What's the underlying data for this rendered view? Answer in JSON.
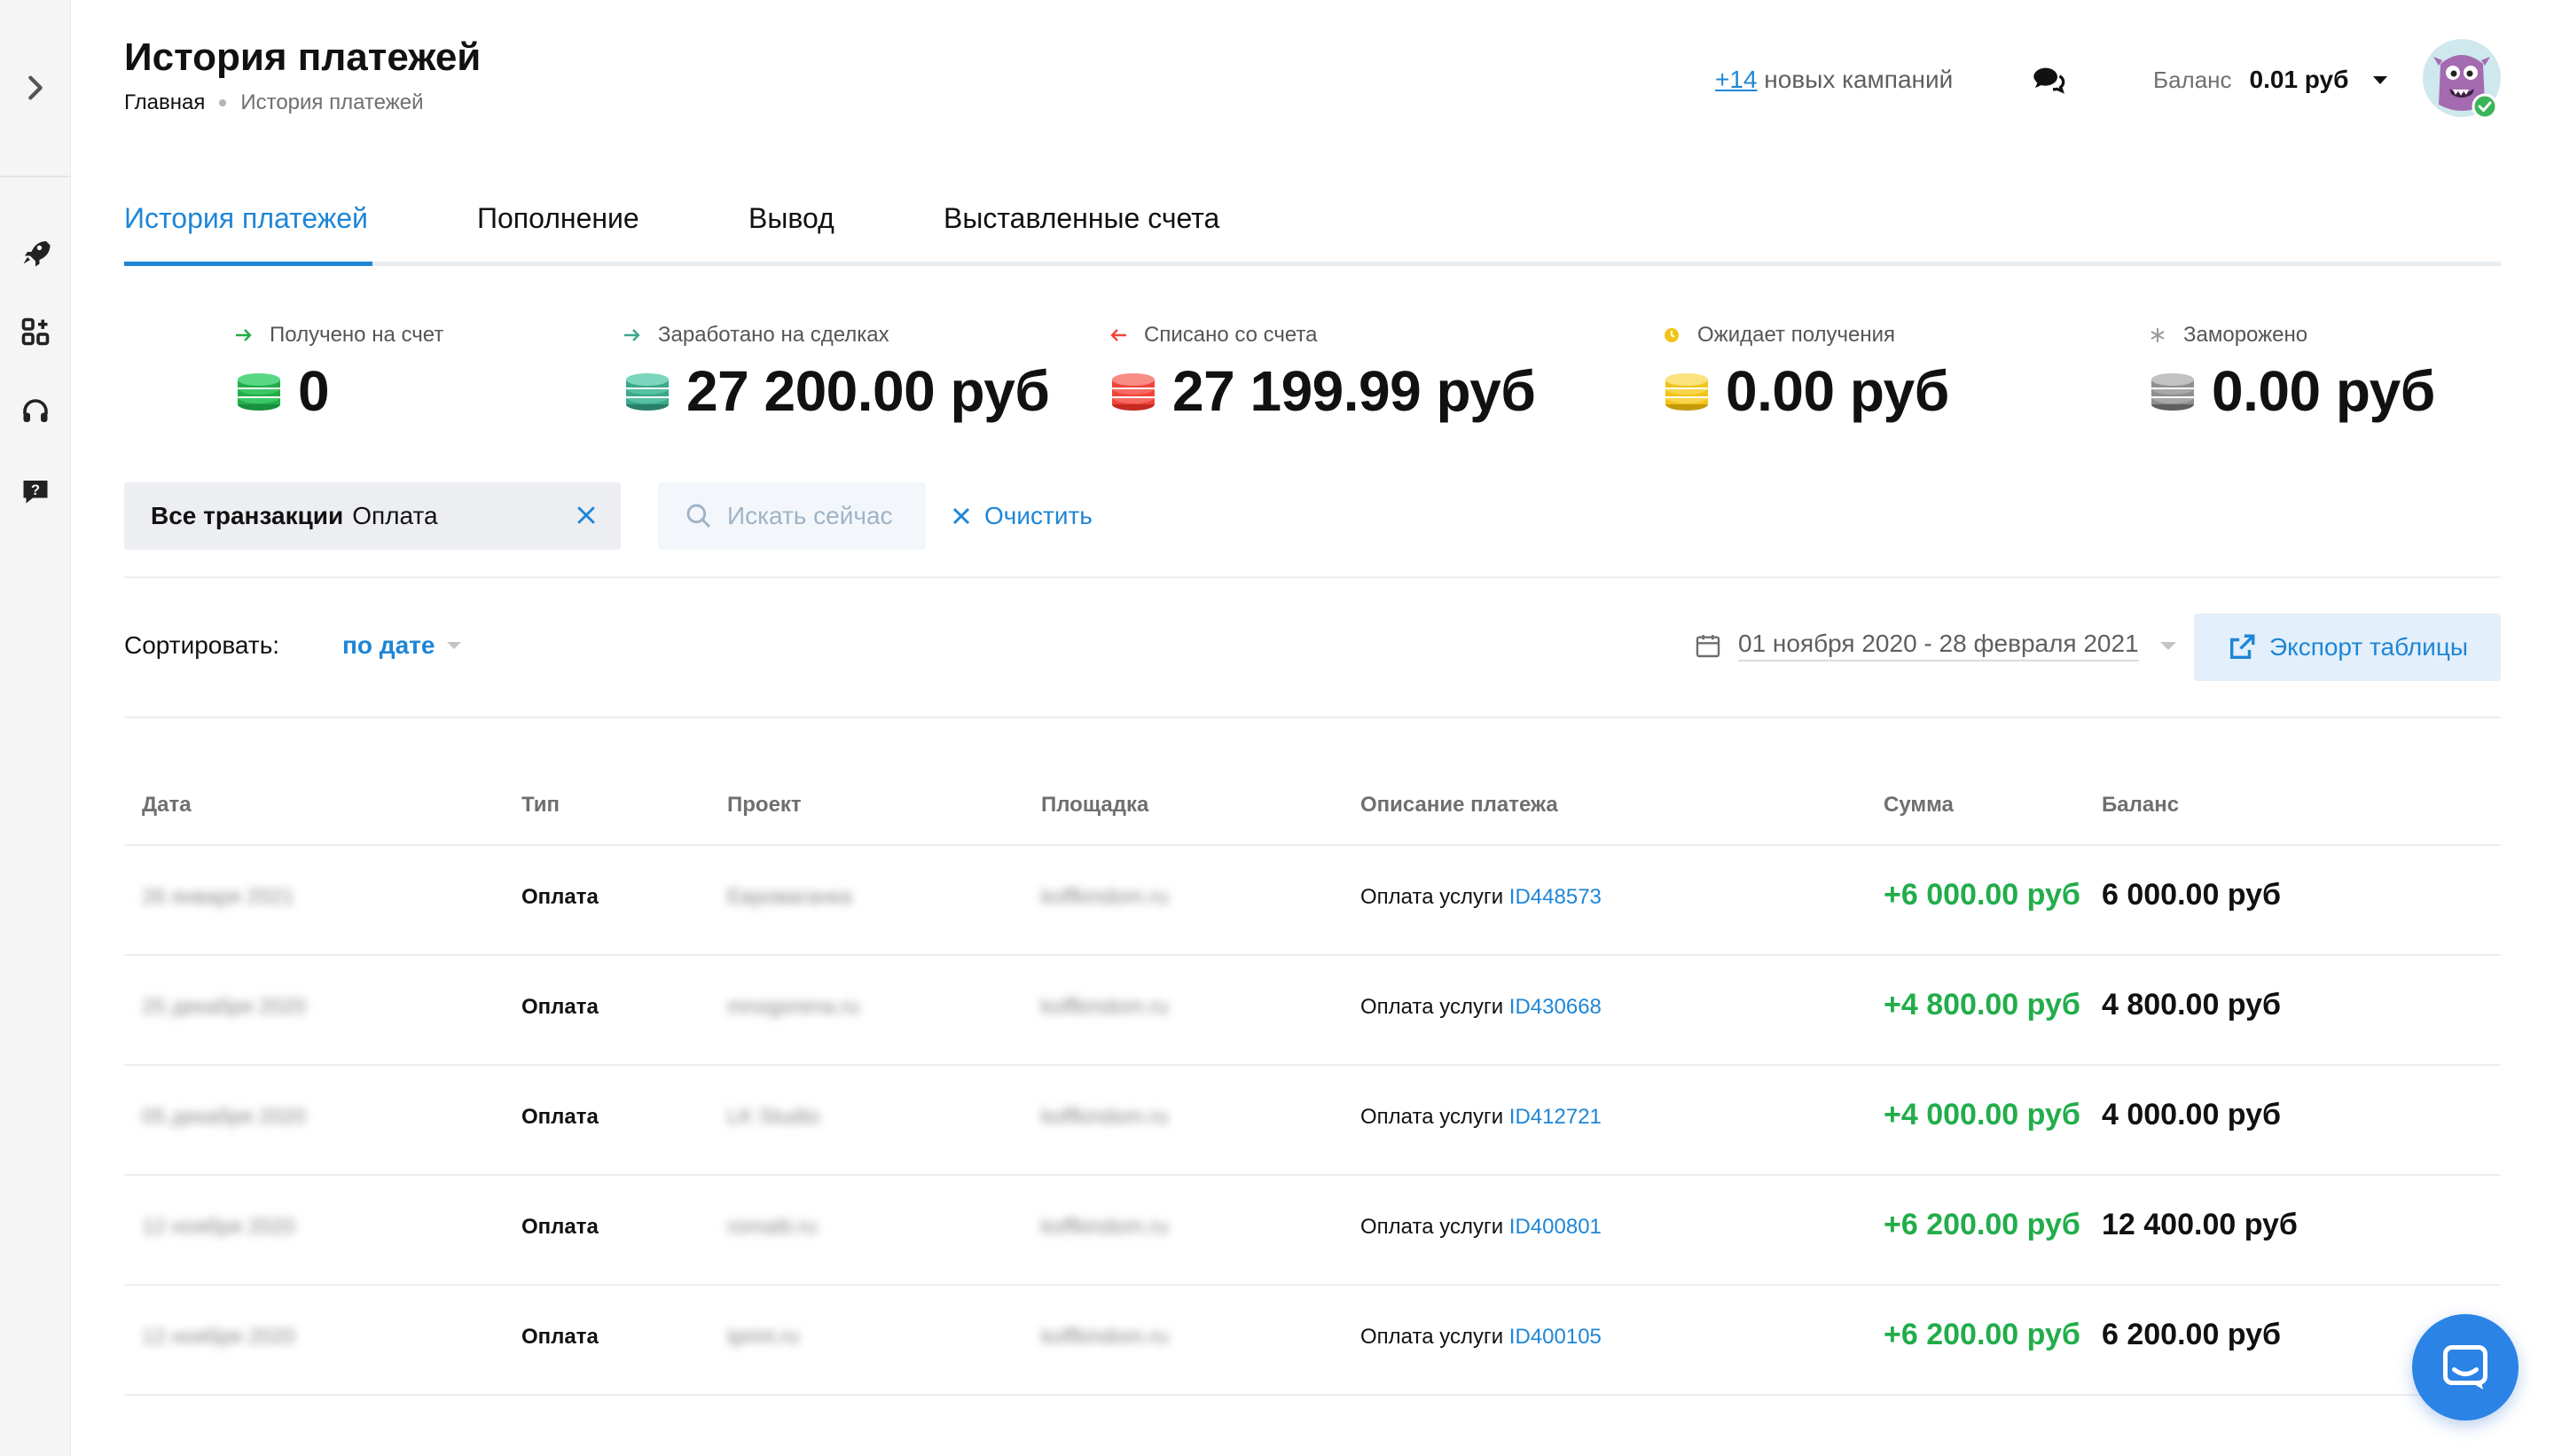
{
  "header": {
    "title": "История платежей",
    "breadcrumb": {
      "home": "Главная",
      "current": "История платежей"
    },
    "campaigns": {
      "count": "+14",
      "text": "новых кампаний"
    },
    "balance": {
      "label": "Баланс",
      "value": "0.01 руб"
    }
  },
  "tabs": [
    {
      "label": "История платежей",
      "active": true
    },
    {
      "label": "Пополнение",
      "active": false
    },
    {
      "label": "Вывод",
      "active": false
    },
    {
      "label": "Выставленные счета",
      "active": false
    }
  ],
  "stats": [
    {
      "label": "Получено на счет",
      "value": "0",
      "indicator": "arrow-right",
      "color": "#22ad4a",
      "coin_color": "#22ad4a"
    },
    {
      "label": "Заработано на сделках",
      "value": "27 200.00 руб",
      "indicator": "arrow-right",
      "color": "#3aa88a",
      "coin_color": "#3aa88a"
    },
    {
      "label": "Списано со счета",
      "value": "27 199.99 руб",
      "indicator": "arrow-left",
      "color": "#f0443a",
      "coin_color": "#f0443a"
    },
    {
      "label": "Ожидает получения",
      "value": "0.00 руб",
      "indicator": "clock",
      "color": "#f2c418",
      "coin_color": "#f2c418"
    },
    {
      "label": "Заморожено",
      "value": "0.00 руб",
      "indicator": "snowflake",
      "color": "#9a9a9a",
      "coin_color": "#8f8f8f"
    }
  ],
  "filter": {
    "key": "Все транзакции",
    "value": "Оплата",
    "search_label": "Искать сейчас",
    "clear_label": "Очистить"
  },
  "sort": {
    "label": "Сортировать:",
    "value": "по дате",
    "date_range": "01 ноября 2020 - 28 февраля 2021",
    "export_label": "Экспорт таблицы"
  },
  "table": {
    "columns": [
      "Дата",
      "Тип",
      "Проект",
      "Площадка",
      "Описание платежа",
      "Сумма",
      "Баланс"
    ],
    "rows": [
      {
        "date": "26 января 2021",
        "type": "Оплата",
        "project": "Евроваганка",
        "site": "koffkindom.ru",
        "desc": "Оплата услуги",
        "id": "ID448573",
        "sum": "+6 000.00 руб",
        "balance": "6 000.00 руб"
      },
      {
        "date": "25 декабря 2020",
        "type": "Оплата",
        "project": "mnogorena.ru",
        "site": "koffkindom.ru",
        "desc": "Оплата услуги",
        "id": "ID430668",
        "sum": "+4 800.00 руб",
        "balance": "4 800.00 руб"
      },
      {
        "date": "05 декабря 2020",
        "type": "Оплата",
        "project": "LK Studio",
        "site": "koffkindom.ru",
        "desc": "Оплата услуги",
        "id": "ID412721",
        "sum": "+4 000.00 руб",
        "balance": "4 000.00 руб"
      },
      {
        "date": "12 ноября 2020",
        "type": "Оплата",
        "project": "romatti.ru",
        "site": "koffkindom.ru",
        "desc": "Оплата услуги",
        "id": "ID400801",
        "sum": "+6 200.00 руб",
        "balance": "12 400.00 руб"
      },
      {
        "date": "12 ноября 2020",
        "type": "Оплата",
        "project": "tprint.ru",
        "site": "koffkindom.ru",
        "desc": "Оплата услуги",
        "id": "ID400105",
        "sum": "+6 200.00 руб",
        "balance": "6 200.00 руб"
      }
    ]
  },
  "colors": {
    "accent": "#1e86d6",
    "positive": "#22ad4a",
    "negative": "#f0443a",
    "pending": "#f2c418"
  }
}
